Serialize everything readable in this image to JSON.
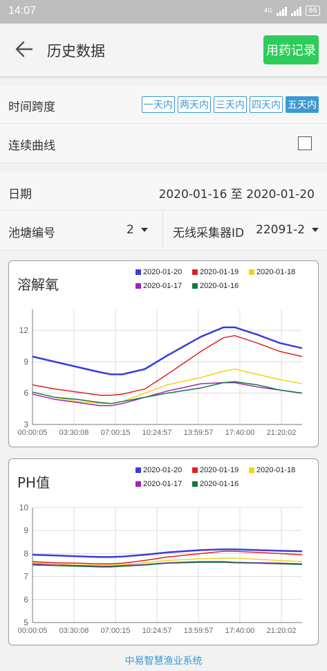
{
  "status_bar": {
    "time": "14:07",
    "network": "4G",
    "battery": "86"
  },
  "app_bar": {
    "title": "历史数据",
    "med_button": "用药记录"
  },
  "time_span": {
    "label": "时间跨度",
    "options": [
      "一天内",
      "两天内",
      "三天内",
      "四天内",
      "五天内"
    ],
    "selected": "五天内"
  },
  "continuous": {
    "label": "连续曲线",
    "checked": false
  },
  "date": {
    "label": "日期",
    "value": "2020-01-16 至 2020-01-20"
  },
  "pond": {
    "label": "池塘编号",
    "value": "2"
  },
  "collector": {
    "label": "无线采集器ID",
    "value": "22091-2"
  },
  "colors": {
    "accent": "#3a9ad3",
    "med_button": "#2ecc5a"
  },
  "chart_data": [
    {
      "type": "line",
      "title": "溶解氧",
      "xlabel": "",
      "ylabel": "",
      "x_ticks": [
        "00:00:05",
        "03:30:08",
        "07:00:15",
        "10:24:57",
        "13:59:57",
        "17:40:00",
        "21:20:02"
      ],
      "ylim": [
        3,
        14
      ],
      "y_ticks": [
        3,
        6,
        9,
        12
      ],
      "grid": true,
      "legend_position": "top",
      "x": [
        0,
        2,
        4,
        6,
        7,
        8,
        10,
        12,
        15,
        17,
        18,
        20,
        22,
        24
      ],
      "series": [
        {
          "name": "2020-01-20",
          "color": "#3b3bdc",
          "values": [
            9.5,
            9.0,
            8.5,
            8.0,
            7.8,
            7.8,
            8.3,
            9.6,
            11.4,
            12.3,
            12.3,
            11.6,
            10.8,
            10.3
          ]
        },
        {
          "name": "2020-01-19",
          "color": "#e02020",
          "values": [
            6.8,
            6.4,
            6.1,
            5.8,
            5.8,
            5.9,
            6.4,
            7.8,
            10.0,
            11.3,
            11.5,
            10.8,
            10.0,
            9.5
          ]
        },
        {
          "name": "2020-01-18",
          "color": "#f2d21a",
          "values": [
            6.1,
            5.6,
            5.2,
            5.0,
            5.0,
            5.2,
            6.0,
            6.8,
            7.5,
            8.1,
            8.3,
            7.8,
            7.3,
            6.9
          ]
        },
        {
          "name": "2020-01-17",
          "color": "#a020c0",
          "values": [
            5.9,
            5.4,
            5.1,
            4.8,
            4.8,
            5.0,
            5.6,
            6.2,
            6.9,
            7.0,
            7.0,
            6.6,
            6.3,
            6.0
          ]
        },
        {
          "name": "2020-01-16",
          "color": "#117a3a",
          "values": [
            6.1,
            5.6,
            5.4,
            5.1,
            5.0,
            5.2,
            5.6,
            6.0,
            6.5,
            7.0,
            7.1,
            6.8,
            6.3,
            6.0
          ]
        }
      ]
    },
    {
      "type": "line",
      "title": "PH值",
      "xlabel": "",
      "ylabel": "",
      "x_ticks": [
        "00:00:05",
        "03:30:08",
        "07:00:15",
        "10:24:57",
        "13:59:57",
        "17:40:00",
        "21:20:02"
      ],
      "ylim": [
        5,
        10
      ],
      "y_ticks": [
        5,
        6,
        7,
        8,
        9,
        10
      ],
      "grid": true,
      "legend_position": "top",
      "x": [
        0,
        2,
        4,
        6,
        7,
        8,
        10,
        12,
        15,
        17,
        18,
        20,
        22,
        24
      ],
      "series": [
        {
          "name": "2020-01-20",
          "color": "#3b3bdc",
          "values": [
            7.95,
            7.92,
            7.88,
            7.85,
            7.85,
            7.87,
            7.95,
            8.05,
            8.15,
            8.18,
            8.18,
            8.15,
            8.12,
            8.1
          ]
        },
        {
          "name": "2020-01-19",
          "color": "#e02020",
          "values": [
            7.65,
            7.6,
            7.58,
            7.55,
            7.55,
            7.58,
            7.7,
            7.85,
            8.0,
            8.1,
            8.1,
            8.05,
            8.0,
            7.95
          ]
        },
        {
          "name": "2020-01-18",
          "color": "#f2d21a",
          "values": [
            7.6,
            7.55,
            7.5,
            7.5,
            7.5,
            7.52,
            7.6,
            7.7,
            7.78,
            7.8,
            7.8,
            7.75,
            7.7,
            7.65
          ]
        },
        {
          "name": "2020-01-17",
          "color": "#a020c0",
          "values": [
            7.55,
            7.5,
            7.48,
            7.45,
            7.45,
            7.48,
            7.52,
            7.6,
            7.65,
            7.65,
            7.62,
            7.6,
            7.58,
            7.55
          ]
        },
        {
          "name": "2020-01-16",
          "color": "#117a3a",
          "values": [
            7.5,
            7.48,
            7.45,
            7.42,
            7.42,
            7.45,
            7.5,
            7.58,
            7.62,
            7.62,
            7.6,
            7.58,
            7.55,
            7.52
          ]
        }
      ]
    }
  ],
  "footer": "中易智慧渔业系统"
}
